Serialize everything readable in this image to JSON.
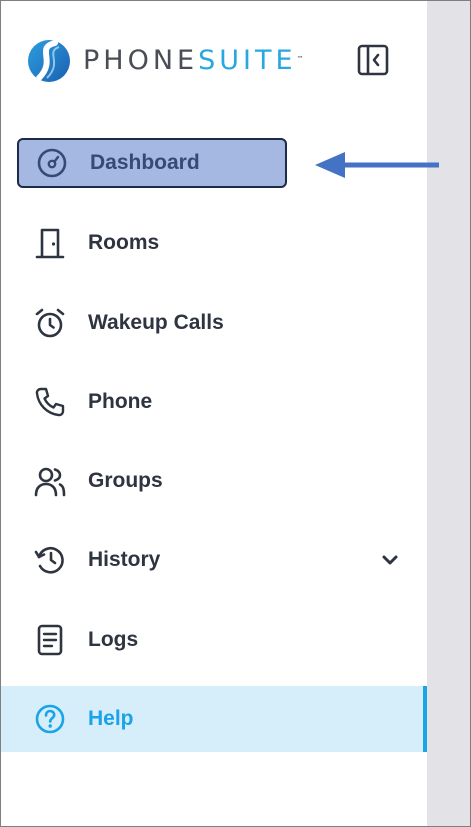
{
  "brand": {
    "name_part1": "PHONE",
    "name_part2": "SUITE",
    "trademark": "™",
    "colors": {
      "gray": "#4a4d55",
      "blue": "#29a8e0"
    }
  },
  "header": {
    "collapse_icon": "sidebar-collapse-icon"
  },
  "nav": {
    "items": [
      {
        "label": "Dashboard",
        "icon": "dashboard-gauge-icon",
        "selected": true
      },
      {
        "label": "Rooms",
        "icon": "door-icon"
      },
      {
        "label": "Wakeup Calls",
        "icon": "alarm-clock-icon"
      },
      {
        "label": "Phone",
        "icon": "phone-icon"
      },
      {
        "label": "Groups",
        "icon": "users-icon"
      },
      {
        "label": "History",
        "icon": "history-icon",
        "expandable": true
      },
      {
        "label": "Logs",
        "icon": "document-icon"
      },
      {
        "label": "Help",
        "icon": "help-circle-icon",
        "active": true
      }
    ]
  },
  "colors": {
    "selected_bg": "#a4b8e2",
    "selected_border": "#1e2a4a",
    "help_bg": "#d6eefa",
    "help_accent": "#1aa3e8",
    "annotation_arrow": "#4472c4",
    "right_pane": "#e3e3e7"
  }
}
